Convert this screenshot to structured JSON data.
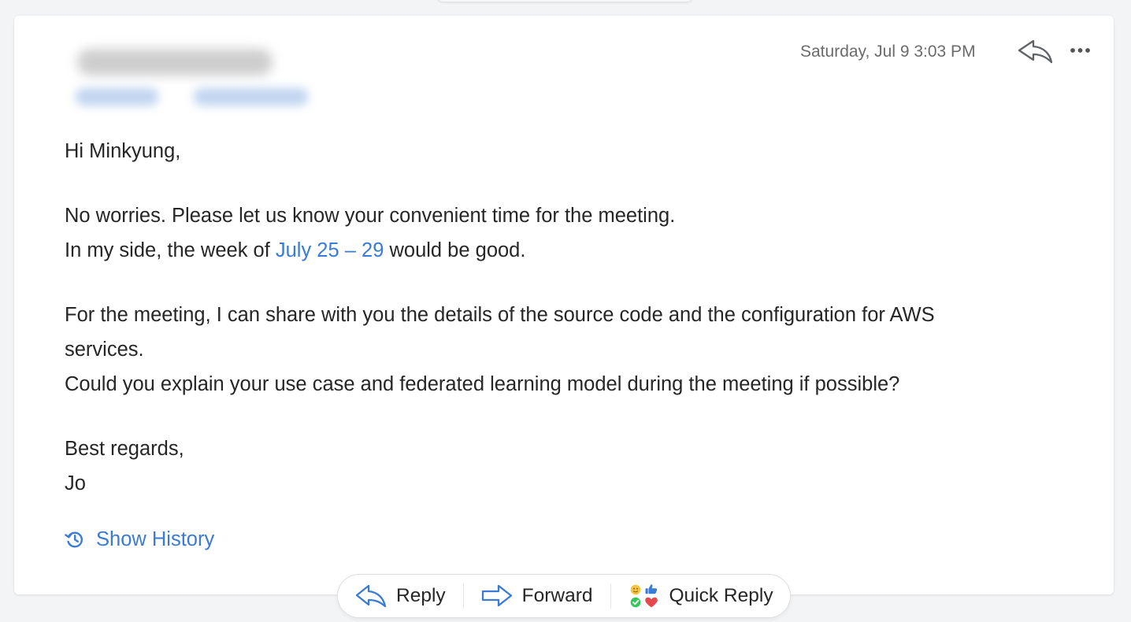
{
  "email": {
    "date": "Saturday, Jul 9 3:03 PM",
    "body": {
      "greeting": "Hi Minkyung,",
      "p1_line1": "No worries. Please let us know your convenient time for the meeting.",
      "p1_line2_pre": "In my side, the week of ",
      "p1_line2_link": "July 25 – 29",
      "p1_line2_post": " would be good.",
      "p2_line1": "For the meeting, I can share with you the details of the source code and the configuration for AWS",
      "p2_line2": "services.",
      "p2_line3": "Could you explain your use case and federated learning model during the meeting if possible?",
      "closing": "Best regards,",
      "signature": "Jo"
    },
    "show_history": "Show History"
  },
  "actions": {
    "reply": "Reply",
    "forward": "Forward",
    "quick_reply": "Quick Reply"
  },
  "icons": {
    "header_reply": "reply-arrow-icon",
    "header_more": "more-horizontal-icon",
    "history": "history-clock-icon",
    "reply": "reply-arrow-icon",
    "forward": "forward-arrow-icon",
    "quick_reply": "quick-reply-emoji-icon"
  },
  "colors": {
    "link": "#3a7bd5",
    "text": "#262626",
    "muted": "#6b6b6b",
    "background": "#f3f4f6"
  }
}
